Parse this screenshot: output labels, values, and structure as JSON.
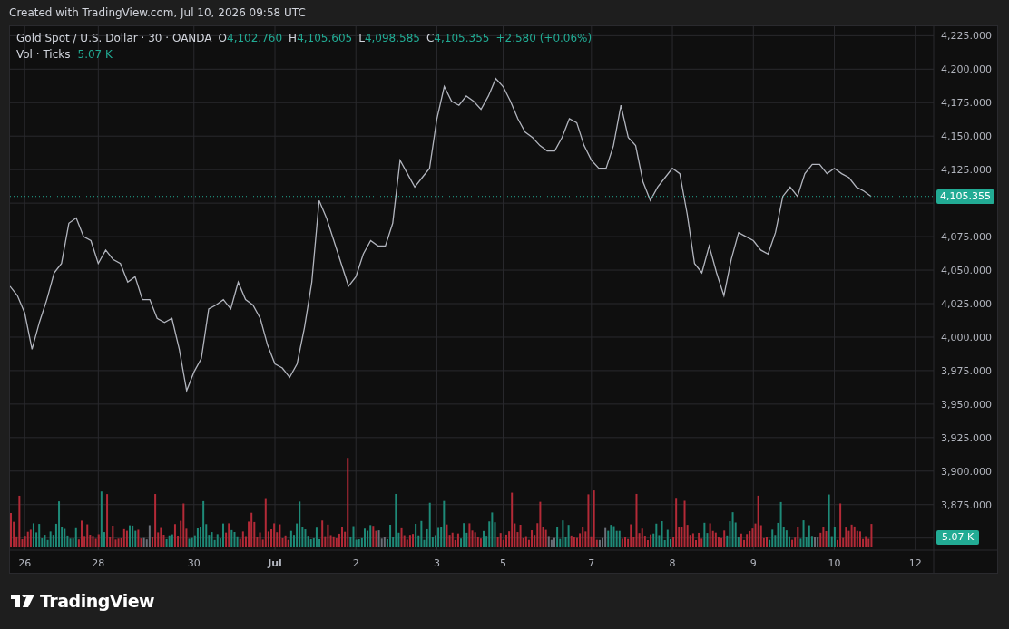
{
  "header": {
    "caption": "Created with TradingView.com, Jul 10, 2026 09:58 UTC"
  },
  "legend": {
    "symbol": "Gold Spot / U.S. Dollar · 30 · OANDA",
    "ohlc": [
      {
        "label": "O",
        "value": "4,102.760"
      },
      {
        "label": "H",
        "value": "4,105.605"
      },
      {
        "label": "L",
        "value": "4,098.585"
      },
      {
        "label": "C",
        "value": "4,105.355"
      }
    ],
    "change": "+2.580 (+0.06%)",
    "volume_label": "Vol · Ticks",
    "volume_value": "5.07 K"
  },
  "price_axis": {
    "last_price": "4,105.355",
    "volume_badge": "5.07 K"
  },
  "chart_data": {
    "type": "line",
    "ylim": [
      3841,
      4232
    ],
    "grid": true,
    "categories": [
      null,
      null,
      "26",
      null,
      null,
      null,
      null,
      null,
      null,
      null,
      null,
      null,
      "28",
      null,
      null,
      null,
      null,
      null,
      null,
      null,
      null,
      null,
      null,
      null,
      null,
      "30",
      null,
      null,
      null,
      null,
      null,
      null,
      null,
      null,
      null,
      null,
      "Jul",
      null,
      null,
      null,
      null,
      null,
      null,
      null,
      null,
      null,
      null,
      "2",
      null,
      null,
      null,
      null,
      null,
      null,
      null,
      null,
      null,
      null,
      "3",
      null,
      null,
      null,
      null,
      null,
      null,
      null,
      null,
      "5",
      null,
      null,
      null,
      null,
      null,
      null,
      null,
      null,
      null,
      null,
      null,
      "7",
      null,
      null,
      null,
      null,
      null,
      null,
      null,
      null,
      null,
      null,
      "8",
      null,
      null,
      null,
      null,
      null,
      null,
      null,
      null,
      null,
      null,
      "9",
      null,
      null,
      null,
      null,
      null,
      null,
      null,
      null,
      null,
      null,
      "10",
      null,
      null,
      null,
      null,
      null,
      null,
      null,
      null,
      null,
      null,
      "12",
      null
    ],
    "series": [
      {
        "color": "#b2b5be",
        "values": [
          4038,
          4031,
          4018,
          3991,
          4011,
          4028,
          4048,
          4055,
          4085,
          4089,
          4075,
          4072,
          4055,
          4065,
          4058,
          4055,
          4041,
          4045,
          4028,
          4028,
          4014,
          4011,
          4014,
          3991,
          3960,
          3974,
          3984,
          4021,
          4024,
          4028,
          4021,
          4041,
          4028,
          4024,
          4014,
          3994,
          3980,
          3977,
          3970,
          3980,
          4007,
          4041,
          4102,
          4089,
          4072,
          4055,
          4038,
          4045,
          4062,
          4072,
          4068,
          4068,
          4085,
          4132,
          4122,
          4112,
          4119,
          4126,
          4163,
          4187,
          4176,
          4173,
          4180,
          4176,
          4170,
          4180,
          4193,
          4187,
          4176,
          4163,
          4153,
          4149,
          4143,
          4139,
          4139,
          4149,
          4163,
          4160,
          4143,
          4132,
          4126,
          4126,
          4143,
          4173,
          4149,
          4143,
          4116,
          4102,
          4112,
          4119,
          4126,
          4122,
          4092,
          4055,
          4048,
          4068,
          4048,
          4031,
          4058,
          4078,
          4075,
          4072,
          4065,
          4062,
          4078,
          4105,
          4112,
          4105,
          4122,
          4129,
          4129,
          4122,
          4126,
          4122,
          4119,
          4112,
          4109,
          4105,
          null,
          null,
          null,
          null,
          null,
          null,
          null
        ]
      }
    ],
    "yticks": [
      {
        "value": 4225,
        "label": "4,225.000"
      },
      {
        "value": 4200,
        "label": "4,200.000"
      },
      {
        "value": 4175,
        "label": "4,175.000"
      },
      {
        "value": 4150,
        "label": "4,150.000"
      },
      {
        "value": 4125,
        "label": "4,125.000"
      },
      {
        "value": 4075,
        "label": "4,075.000"
      },
      {
        "value": 4050,
        "label": "4,050.000"
      },
      {
        "value": 4025,
        "label": "4,025.000"
      },
      {
        "value": 4000,
        "label": "4,000.000"
      },
      {
        "value": 3975,
        "label": "3,975.000"
      },
      {
        "value": 3950,
        "label": "3,950.000"
      },
      {
        "value": 3925,
        "label": "3,925.000"
      },
      {
        "value": 3900,
        "label": "3,900.000"
      },
      {
        "value": 3875,
        "label": "3,875.000"
      }
    ]
  },
  "footer": {
    "brand": "TradingView"
  }
}
